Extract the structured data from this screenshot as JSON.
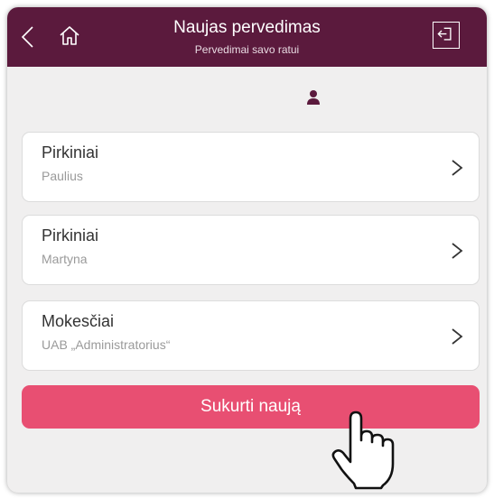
{
  "header": {
    "title": "Naujas pervedimas",
    "subtitle": "Pervedimai savo ratui",
    "back_icon": "chevron-left-icon",
    "home_icon": "home-icon",
    "exit_icon": "logout-icon",
    "background_color": "#5b1a3d"
  },
  "user_icon": "user-icon",
  "recipients": [
    {
      "name": "Pirkiniai",
      "sub": "Paulius"
    },
    {
      "name": "Pirkiniai",
      "sub": "Martyna"
    },
    {
      "name": "Mokesčiai",
      "sub": "UAB „Administratorius“"
    }
  ],
  "create_button": {
    "label": "Sukurti naują",
    "color": "#e84f72"
  },
  "cursor_icon": "hand-pointer-icon"
}
